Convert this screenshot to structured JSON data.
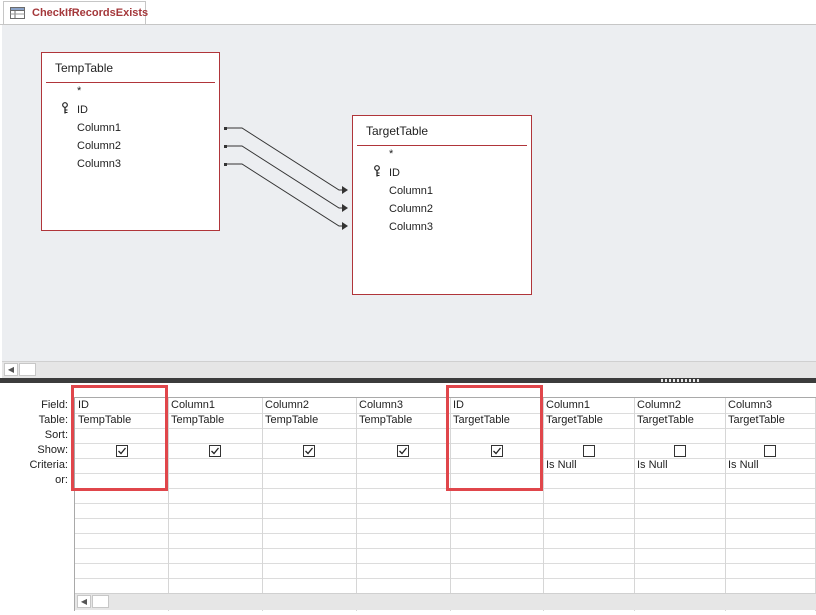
{
  "tab": {
    "title": "CheckIfRecordsExists",
    "icon": "query-icon"
  },
  "tables": [
    {
      "name": "TempTable",
      "fields": [
        "*",
        "ID",
        "Column1",
        "Column2",
        "Column3"
      ],
      "primary_key": "ID"
    },
    {
      "name": "TargetTable",
      "fields": [
        "*",
        "ID",
        "Column1",
        "Column2",
        "Column3"
      ],
      "primary_key": "ID"
    }
  ],
  "joins": [
    {
      "from": "TempTable.Column1",
      "to": "TargetTable.ID"
    },
    {
      "from": "TempTable.Column2",
      "to": "TargetTable.Column1"
    },
    {
      "from": "TempTable.Column3",
      "to": "TargetTable.Column2"
    }
  ],
  "grid": {
    "row_labels": [
      "Field:",
      "Table:",
      "Sort:",
      "Show:",
      "Criteria:",
      "or:"
    ],
    "columns": [
      {
        "field": "ID",
        "table": "TempTable",
        "sort": "",
        "show": true,
        "criteria": "",
        "or": "",
        "highlighted": true
      },
      {
        "field": "Column1",
        "table": "TempTable",
        "sort": "",
        "show": true,
        "criteria": "",
        "or": "",
        "highlighted": false
      },
      {
        "field": "Column2",
        "table": "TempTable",
        "sort": "",
        "show": true,
        "criteria": "",
        "or": "",
        "highlighted": false
      },
      {
        "field": "Column3",
        "table": "TempTable",
        "sort": "",
        "show": true,
        "criteria": "",
        "or": "",
        "highlighted": false
      },
      {
        "field": "ID",
        "table": "TargetTable",
        "sort": "",
        "show": true,
        "criteria": "",
        "or": "",
        "highlighted": true
      },
      {
        "field": "Column1",
        "table": "TargetTable",
        "sort": "",
        "show": false,
        "criteria": "Is Null",
        "or": "",
        "highlighted": false
      },
      {
        "field": "Column2",
        "table": "TargetTable",
        "sort": "",
        "show": false,
        "criteria": "Is Null",
        "or": "",
        "highlighted": false
      },
      {
        "field": "Column3",
        "table": "TargetTable",
        "sort": "",
        "show": false,
        "criteria": "Is Null",
        "or": "",
        "highlighted": false
      }
    ]
  },
  "colors": {
    "accent": "#a4373a",
    "table_border": "#b0353a",
    "highlight": "#e0464b",
    "pane_bg": "#eceef1"
  }
}
